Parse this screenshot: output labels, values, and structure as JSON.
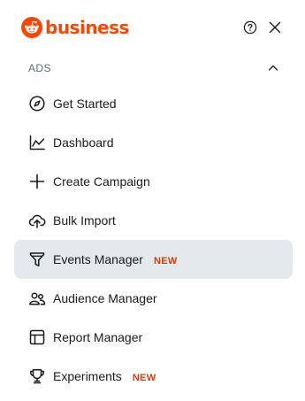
{
  "brand": {
    "name": "business",
    "color": "#ff4500"
  },
  "header": {
    "help_icon": "help-circle-icon",
    "close_icon": "close-icon"
  },
  "section": {
    "title": "ADS",
    "expanded": true
  },
  "nav": {
    "items": [
      {
        "label": "Get Started",
        "icon": "compass-icon",
        "badge": ""
      },
      {
        "label": "Dashboard",
        "icon": "chart-line-icon",
        "badge": ""
      },
      {
        "label": "Create Campaign",
        "icon": "plus-icon",
        "badge": ""
      },
      {
        "label": "Bulk Import",
        "icon": "cloud-upload-icon",
        "badge": ""
      },
      {
        "label": "Events Manager",
        "icon": "funnel-icon",
        "badge": "NEW",
        "active": true
      },
      {
        "label": "Audience Manager",
        "icon": "users-icon",
        "badge": ""
      },
      {
        "label": "Report Manager",
        "icon": "table-icon",
        "badge": ""
      },
      {
        "label": "Experiments",
        "icon": "trophy-icon",
        "badge": "NEW"
      }
    ]
  },
  "colors": {
    "accent": "#ff4500",
    "badge": "#d93a00",
    "active_bg": "#e4e9ec",
    "section_text": "#576f76"
  }
}
